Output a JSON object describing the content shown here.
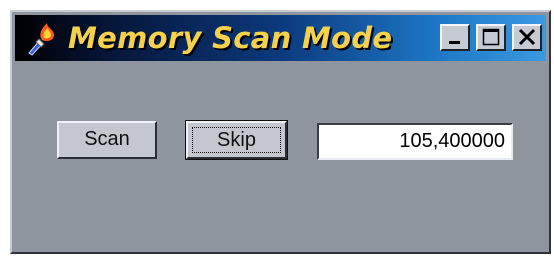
{
  "window": {
    "title": "Memory Scan Mode",
    "app_icon": "torch-icon",
    "controls": {
      "minimize_icon": "minimize-icon",
      "maximize_icon": "maximize-icon",
      "close_icon": "close-icon"
    }
  },
  "actions": {
    "scan_label": "Scan",
    "skip_label": "Skip"
  },
  "value_field": {
    "value": "105,400000"
  },
  "colors": {
    "window_bg": "#8e959e",
    "title_text": "#f6d24a",
    "button_face": "#c4c8ce"
  }
}
